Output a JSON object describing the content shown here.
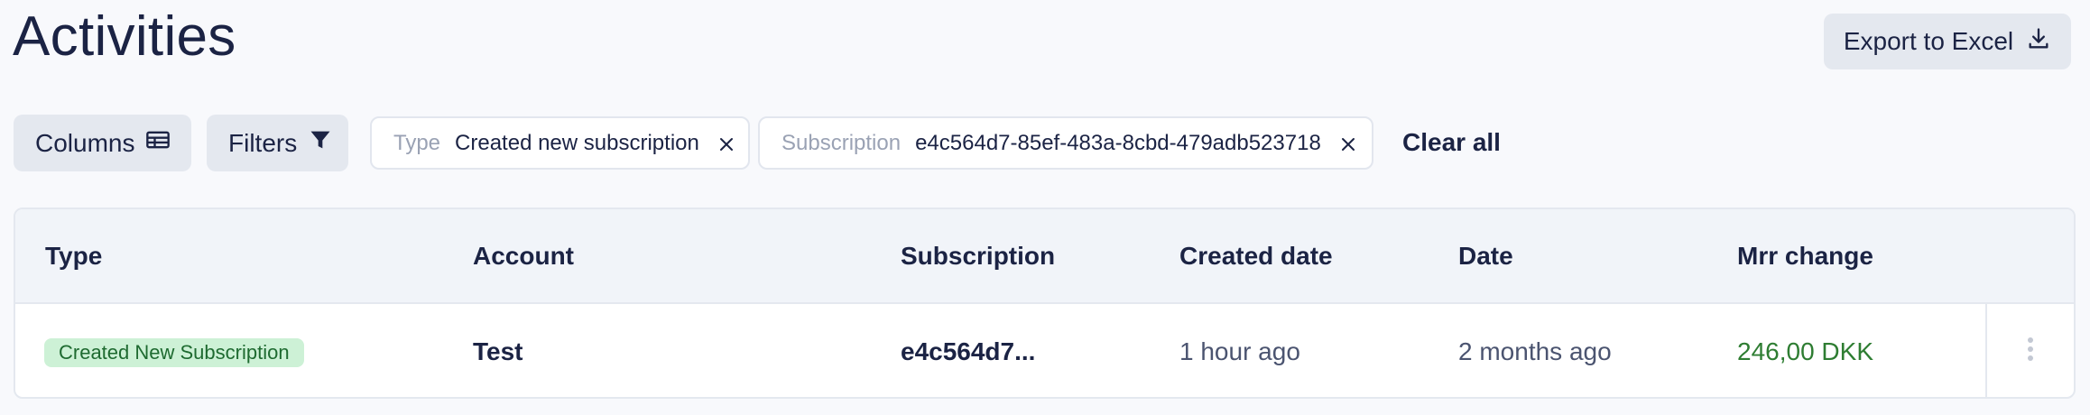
{
  "header": {
    "title": "Activities",
    "export_label": "Export to Excel"
  },
  "toolbar": {
    "columns_label": "Columns",
    "filters_label": "Filters",
    "clear_all_label": "Clear all",
    "filter_chips": [
      {
        "label": "Type",
        "value": "Created new subscription"
      },
      {
        "label": "Subscription",
        "value": "e4c564d7-85ef-483a-8cbd-479adb523718"
      }
    ]
  },
  "table": {
    "columns": [
      "Type",
      "Account",
      "Subscription",
      "Created date",
      "Date",
      "Mrr change"
    ],
    "rows": [
      {
        "type": "Created New Subscription",
        "account": "Test",
        "subscription": "e4c564d7...",
        "created_date": "1 hour ago",
        "date": "2 months ago",
        "mrr_change": "246,00 DKK"
      }
    ]
  },
  "icons": {
    "export": "download-icon",
    "columns": "table-icon",
    "filters": "funnel-icon",
    "chip_close": "close-icon",
    "row_actions": "kebab-menu-icon"
  },
  "colors": {
    "text_primary": "#1b2344",
    "button_bg": "#e4e8ef",
    "badge_bg": "#cdf1d6",
    "badge_text": "#1e6a30",
    "mrr_positive": "#2e7d32"
  }
}
